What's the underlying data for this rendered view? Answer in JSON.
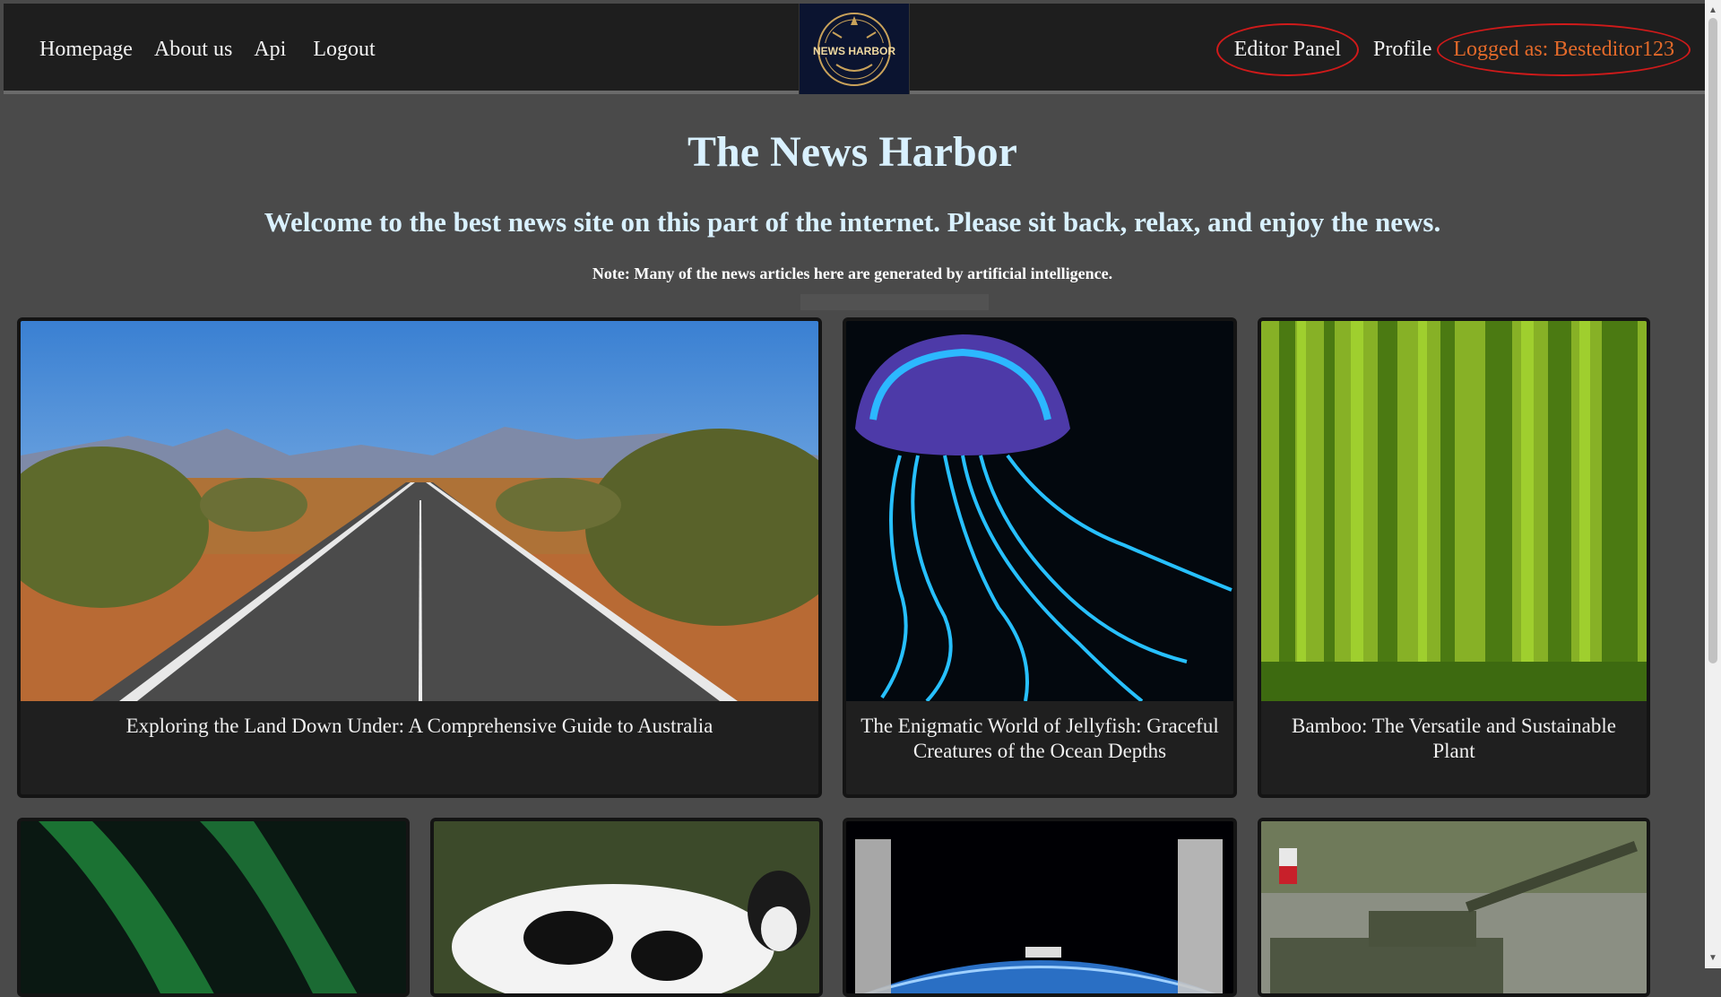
{
  "nav": {
    "links": [
      "Homepage",
      "About us",
      "Api",
      "Logout"
    ],
    "logo_text": "NEWS HARBOR",
    "editor_panel": "Editor Panel",
    "profile": "Profile",
    "logged_as": "Logged as: Besteditor123"
  },
  "header": {
    "title": "The News Harbor",
    "subtitle": "Welcome to the best news site on this part of the internet. Please sit back, relax, and enjoy the news.",
    "note": "Note: Many of the news articles here are generated by artificial intelligence."
  },
  "articles": [
    {
      "title": "Exploring the Land Down Under: A Comprehensive Guide to Australia",
      "image": "outback-road"
    },
    {
      "title": "The Enigmatic World of Jellyfish: Graceful Creatures of the Ocean Depths",
      "image": "jellyfish"
    },
    {
      "title": "Bamboo: The Versatile and Sustainable Plant",
      "image": "bamboo-forest"
    },
    {
      "title": "",
      "image": "aurora"
    },
    {
      "title": "",
      "image": "cow"
    },
    {
      "title": "",
      "image": "space-station"
    },
    {
      "title": "",
      "image": "tank"
    }
  ],
  "colors": {
    "page_bg": "#4a4a4a",
    "topbar_bg": "#1e1e1e",
    "title": "#d9f1ff",
    "logged_as": "#e36a2a",
    "annotation_circle": "#d01a1a"
  }
}
